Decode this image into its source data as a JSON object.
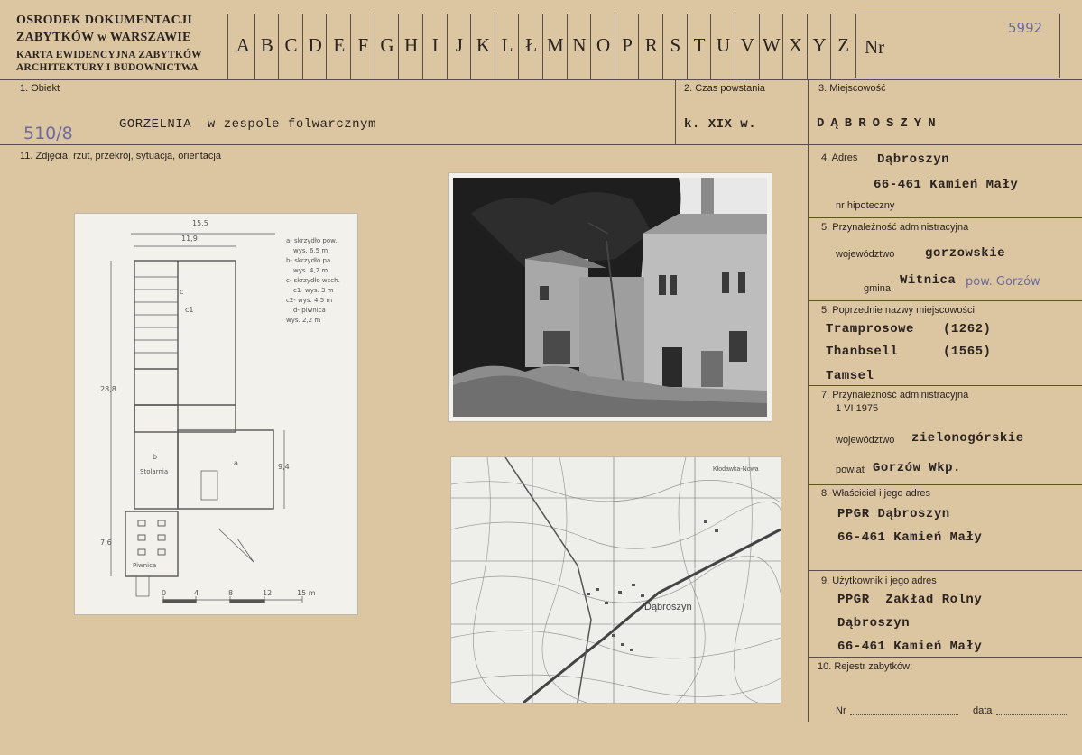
{
  "header": {
    "org_line1": "OSRODEK DOKUMENTACJI",
    "org_line2": "ZABYTKÓW w WARSZAWIE",
    "org_line3": "KARTA EWIDENCYJNA ZABYTKÓW",
    "org_line4": "ARCHITEKTURY I BUDOWNICTWA",
    "alphabet": [
      "A",
      "B",
      "C",
      "D",
      "E",
      "F",
      "G",
      "H",
      "I",
      "J",
      "K",
      "L",
      "Ł",
      "M",
      "N",
      "O",
      "P",
      "R",
      "S",
      "T",
      "U",
      "V",
      "W",
      "X",
      "Y",
      "Z"
    ],
    "nr_label": "Nr",
    "nr_handwritten": "5992"
  },
  "fields": {
    "obiekt_label": "1. Obiekt",
    "obiekt_value": "GORZELNIA  w zespole folwarcznym",
    "obiekt_handnote": "510/8",
    "czas_label": "2. Czas powstania",
    "czas_value": "k. XIX w.",
    "miejscowosc_label": "3. Miejscowość",
    "miejscowosc_value": "DĄBROSZYN",
    "zdjecia_label": "11. Zdjęcia, rzut, przekrój, sytuacja, orientacja",
    "adres_label": "4. Adres",
    "adres_line1": "Dąbroszyn",
    "adres_line2": "66-461 Kamień Mały",
    "hipoteczny_label": "nr hipoteczny",
    "przyn_label": "5. Przynależność administracyjna",
    "woj_label": "województwo",
    "woj_value": "gorzowskie",
    "gmina_label": "gmina",
    "gmina_value": "Witnica",
    "gmina_handnote": "pow. Gorzów",
    "poprz_label": "5. Poprzednie nazwy miejscowości",
    "poprz_1_name": "Tramprosowe",
    "poprz_1_year": "(1262)",
    "poprz_2_name": "Thanbsell",
    "poprz_2_year": "(1565)",
    "poprz_3_name": "Tamsel",
    "przyn7_label": "7. Przynależność administracyjna",
    "przyn7_date": "1 VI 1975",
    "woj7_label": "województwo",
    "woj7_value": "zielonogórskie",
    "powiat_label": "powiat",
    "powiat_value": "Gorzów Wkp.",
    "wlasciciel_label": "8. Właściciel i jego adres",
    "wlasciciel_line1": "PPGR Dąbroszyn",
    "wlasciciel_line2": "66-461 Kamień Mały",
    "uzytkownik_label": "9. Użytkownik i jego adres",
    "uzytkownik_line1": "PPGR  Zakład Rolny",
    "uzytkownik_line2": "Dąbroszyn",
    "uzytkownik_line3": "66-461 Kamień Mały",
    "rejestr_label": "10. Rejestr zabytków:",
    "rejestr_nr_label": "Nr",
    "rejestr_data_label": "data"
  },
  "plan": {
    "dim_top_outer": "15,5",
    "dim_top_inner": "11,9",
    "dim_left": "28,8",
    "dim_right": "9,4",
    "dim_bottom_left": "7,6",
    "legend": [
      "a- skrzydło pow.",
      "wys. 6,5 m",
      "b- skrzydło pa.",
      "wys. 4,2 m",
      "c- skrzydło wsch.",
      "c1- wys. 3 m",
      "c2- wys. 4,5 m",
      "d- piwnica",
      "wys. 2,2 m"
    ],
    "room_a": "a",
    "room_b": "b",
    "room_b_name": "Stolarnia",
    "room_c": "c",
    "room_c1": "c1",
    "room_d": "Piwnica",
    "scale": [
      "0",
      "4",
      "8",
      "12",
      "15 m"
    ]
  },
  "map": {
    "town_label": "Dąbroszyn",
    "label_north": "Kłodawka-Nowa"
  },
  "colors": {
    "card": "#dcc6a2",
    "ink": "#2a2320",
    "handwriting": "#6d6aa0"
  }
}
